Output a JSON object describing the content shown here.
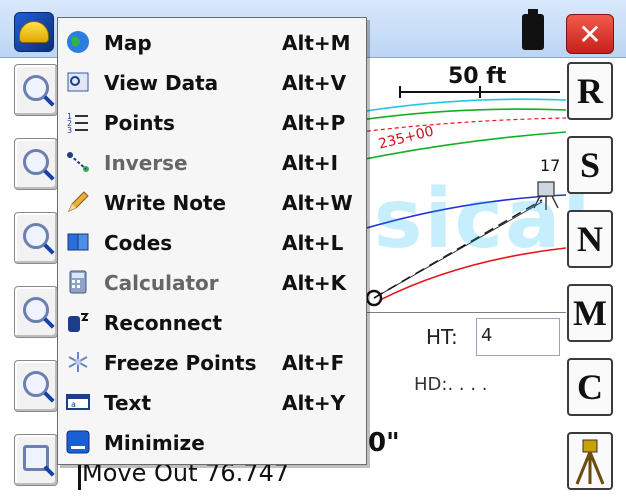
{
  "titlebar": {
    "close_label": "✕",
    "app_logo_icon": "surveyor-hardhat-icon",
    "battery_icon": "battery-icon"
  },
  "tools": [
    {
      "name": "zoom-all-icon"
    },
    {
      "name": "zoom-in-icon"
    },
    {
      "name": "zoom-out-icon"
    },
    {
      "name": "zoom-window-icon"
    },
    {
      "name": "zoom-previous-icon"
    },
    {
      "name": "map-details-icon"
    }
  ],
  "side_buttons": [
    "R",
    "S",
    "N",
    "M",
    "C"
  ],
  "side_instrument_icon": "total-station-tripod-icon",
  "map": {
    "scale_label": "50 ft",
    "station_label": "235+00",
    "point_label": "17"
  },
  "info": {
    "ht_label": "HT:",
    "ht_value": "4",
    "hd_label": "HD:. . . .",
    "angle_partial": "0\"",
    "move_out": "Move Out 76.747"
  },
  "watermark": "Geodesical",
  "menu": {
    "items": [
      {
        "label": "Map",
        "accel": "Alt+M",
        "icon": "globe-icon",
        "dim": false
      },
      {
        "label": "View Data",
        "accel": "Alt+V",
        "icon": "view-data-icon",
        "dim": false
      },
      {
        "label": "Points",
        "accel": "Alt+P",
        "icon": "points-list-icon",
        "dim": false
      },
      {
        "label": "Inverse",
        "accel": "Alt+I",
        "icon": "inverse-icon",
        "dim": true
      },
      {
        "label": "Write Note",
        "accel": "Alt+W",
        "icon": "pencil-icon",
        "dim": false
      },
      {
        "label": "Codes",
        "accel": "Alt+L",
        "icon": "codes-book-icon",
        "dim": false
      },
      {
        "label": "Calculator",
        "accel": "Alt+K",
        "icon": "calculator-icon",
        "dim": true
      },
      {
        "label": "Reconnect",
        "accel": "",
        "icon": "reconnect-icon",
        "dim": false
      },
      {
        "label": "Freeze Points",
        "accel": "Alt+F",
        "icon": "freeze-snowflake-icon",
        "dim": false
      },
      {
        "label": "Text",
        "accel": "Alt+Y",
        "icon": "text-field-icon",
        "dim": false
      },
      {
        "label": "Minimize",
        "accel": "",
        "icon": "minimize-icon",
        "dim": false
      }
    ]
  },
  "colors": {
    "alignment_red": "#e5171c",
    "alignment_green": "#10b021",
    "alignment_blue": "#2330d8",
    "alignment_cyan": "#22c7e8",
    "menu_bg": "#f6f6f6",
    "titlebar_bg": "#cfe1f8"
  }
}
